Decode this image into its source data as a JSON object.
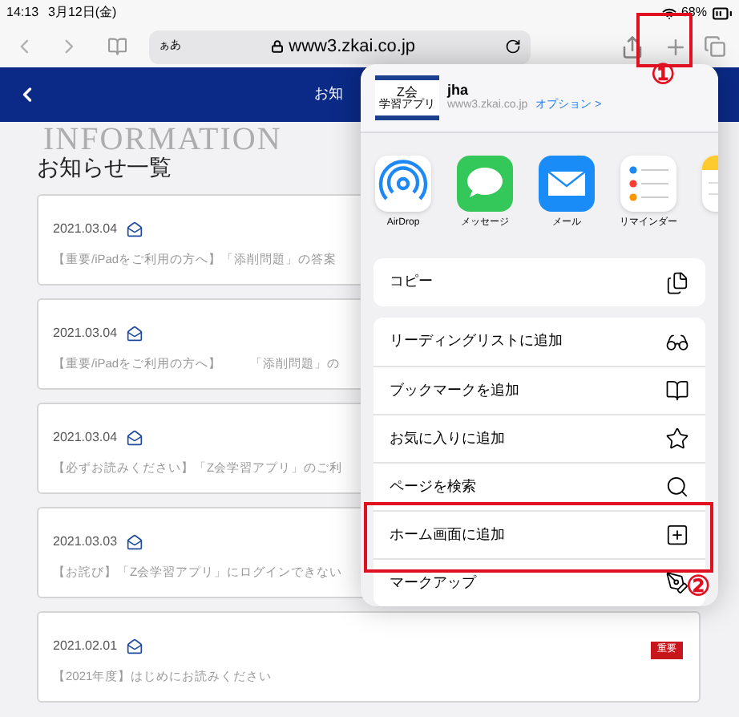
{
  "status_bar": {
    "time": "14:13",
    "date": "3月12日(金)",
    "battery": "68%"
  },
  "toolbar": {
    "text_size": "ぁあ",
    "url": "www3.zkai.co.jp"
  },
  "header": {
    "title": "お知"
  },
  "page": {
    "watermark": "INFORMATION",
    "title": "お知らせ一覧",
    "notices": [
      {
        "date": "2021.03.04",
        "text": "【重要/iPadをご利用の方へ】「添削問題」の答案"
      },
      {
        "date": "2021.03.04",
        "text": "【重要/iPadをご利用の方へ】　　 「添削問題」の"
      },
      {
        "date": "2021.03.04",
        "text": "【必ずお読みください】「Z会学習アプリ」のご利"
      },
      {
        "date": "2021.03.03",
        "text": "【お詫び】「Z会学習アプリ」にログインできない"
      },
      {
        "date": "2021.02.01",
        "text": "【2021年度】はじめにお読みください",
        "badge": "重要"
      }
    ]
  },
  "share_sheet": {
    "logo": "Z会",
    "logo_sub": "学習アプリ",
    "site_name": "jha",
    "site_url": "www3.zkai.co.jp",
    "options": "オプション >",
    "apps": [
      {
        "kind": "airdrop",
        "label": "AirDrop"
      },
      {
        "kind": "messages",
        "label": "メッセージ"
      },
      {
        "kind": "mail",
        "label": "メール"
      },
      {
        "kind": "reminders",
        "label": "リマインダー"
      },
      {
        "kind": "notes"
      }
    ],
    "groups": [
      [
        {
          "kind": "copy",
          "label": "コピー"
        }
      ],
      [
        {
          "kind": "glasses",
          "label": "リーディングリストに追加"
        },
        {
          "kind": "book",
          "label": "ブックマークを追加"
        },
        {
          "kind": "star",
          "label": "お気に入りに追加"
        },
        {
          "kind": "search",
          "label": "ページを検索"
        },
        {
          "kind": "add",
          "label": "ホーム画面に追加"
        },
        {
          "kind": "markup",
          "label": "マークアップ"
        }
      ]
    ]
  },
  "annotations": [
    {
      "label": "①"
    },
    {
      "label": "②"
    }
  ]
}
